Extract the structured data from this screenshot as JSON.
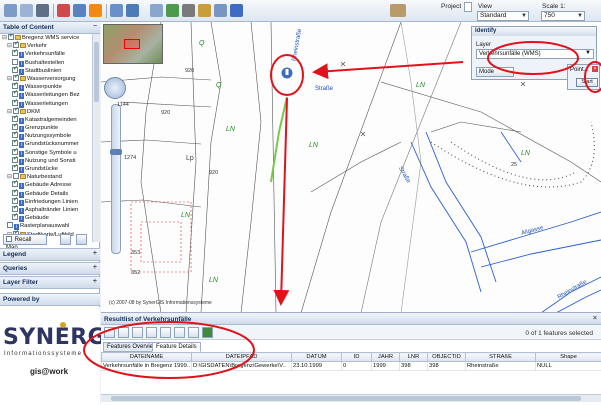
{
  "toolbar": {
    "project_label": "Project",
    "view_label": "View",
    "view_value": "Standard",
    "scale_label": "Scale 1:",
    "scale_value": "750",
    "icons": [
      "pan-icon",
      "zoom-icon",
      "print-icon",
      "select-icon",
      "measure-icon",
      "info-icon",
      "edit-icon",
      "layer-icon",
      "search-icon",
      "bookmark-icon",
      "pen-icon",
      "link-icon",
      "euro-icon",
      "help-icon"
    ]
  },
  "sidebar": {
    "toc_title": "Table of Content",
    "toc_items": [
      {
        "text": "Bregenz WMS service",
        "level": 0,
        "checked": true,
        "kind": "group"
      },
      {
        "text": "Verkehr",
        "level": 1,
        "checked": true,
        "kind": "group"
      },
      {
        "text": "Verkehrsunfälle",
        "level": 2,
        "checked": true,
        "kind": "layer"
      },
      {
        "text": "Bushaltestellen",
        "level": 2,
        "checked": false,
        "kind": "layer"
      },
      {
        "text": "Stadtbuslinien",
        "level": 2,
        "checked": true,
        "kind": "layer"
      },
      {
        "text": "Wasserversorgung",
        "level": 1,
        "checked": true,
        "kind": "group"
      },
      {
        "text": "Wasserpunkte",
        "level": 2,
        "checked": true,
        "kind": "layer"
      },
      {
        "text": "Wasserleitungen Bez",
        "level": 2,
        "checked": true,
        "kind": "layer"
      },
      {
        "text": "Wasserleitungen",
        "level": 2,
        "checked": true,
        "kind": "layer"
      },
      {
        "text": "DKM",
        "level": 1,
        "checked": true,
        "kind": "group"
      },
      {
        "text": "Katastralgemeinden",
        "level": 2,
        "checked": true,
        "kind": "layer"
      },
      {
        "text": "Grenzpunkte",
        "level": 2,
        "checked": true,
        "kind": "layer"
      },
      {
        "text": "Nutzungssymbole",
        "level": 2,
        "checked": true,
        "kind": "layer"
      },
      {
        "text": "Grundstücksnummer",
        "level": 2,
        "checked": true,
        "kind": "layer"
      },
      {
        "text": "Sonstige Symbole u",
        "level": 2,
        "checked": true,
        "kind": "layer"
      },
      {
        "text": "Nutzung und Sonsti",
        "level": 2,
        "checked": true,
        "kind": "layer"
      },
      {
        "text": "Grundstücke",
        "level": 2,
        "checked": true,
        "kind": "layer"
      },
      {
        "text": "Naturbestand",
        "level": 1,
        "checked": false,
        "kind": "group"
      },
      {
        "text": "Gebäude Adresse",
        "level": 2,
        "checked": true,
        "kind": "layer"
      },
      {
        "text": "Gebäude Details",
        "level": 2,
        "checked": true,
        "kind": "layer"
      },
      {
        "text": "Einfriedungen Linien",
        "level": 2,
        "checked": true,
        "kind": "layer"
      },
      {
        "text": "Asphaltränder Linien",
        "level": 2,
        "checked": true,
        "kind": "layer"
      },
      {
        "text": "Gebäude",
        "level": 2,
        "checked": true,
        "kind": "layer"
      },
      {
        "text": "Rasterplanauswahl",
        "level": 1,
        "checked": false,
        "kind": "layer"
      },
      {
        "text": "Stadtkarte/Luftbild",
        "level": 1,
        "checked": true,
        "kind": "group"
      }
    ],
    "recall_label": "Recall Map",
    "legend": "Legend",
    "queries": "Queries",
    "layer_filter": "Layer Filter",
    "powered_by": "Powered by",
    "logo_text": "SYNERGIS",
    "logo_sub": "Informationssysteme",
    "product": "gis@work"
  },
  "map": {
    "labels_green": [
      "Q",
      "Q",
      "LN",
      "LN",
      "LN",
      "LN",
      "LN",
      "LN",
      "Lp",
      "V",
      "V",
      "V",
      "V",
      "V"
    ],
    "numbers": [
      "920",
      "6",
      "1144",
      "920",
      "6",
      "920",
      "10",
      "1274",
      "920",
      "15",
      "920",
      "5",
      "LN",
      "25",
      "7",
      "8",
      "353",
      "2",
      "352",
      "7",
      "9",
      "4",
      "6"
    ],
    "streets": [
      "Straße",
      "Straße",
      "Aligasse",
      "Rheinstraße",
      "Rheinstraße"
    ],
    "copyright": "(c) 2007-08 by SynerGIS Informationssysteme"
  },
  "identify": {
    "title": "Identify",
    "layer_label": "Layer",
    "layer_value": "Verkehrsunfälle (WMS)",
    "mode_label": "Mode"
  },
  "point_window": {
    "title": "Point...",
    "start": "Start"
  },
  "results": {
    "title": "Resultlist of Verkehrsunfälle",
    "count": "0 of 1 features selected",
    "tabs": [
      "Features Overview",
      "Feature Details"
    ],
    "columns": [
      "DATEINAME",
      "DATEIPFAD",
      "DATUM",
      "ID",
      "JAHR",
      "LNR",
      "OBJECTID",
      "STRAßE",
      "Shape"
    ],
    "rows": [
      [
        "Verkehrsunfälle in Bregenz 1999..",
        "D:\\GISDATEN\\Bregenz\\Gewerke\\V..",
        "23.10.1999",
        "0",
        "1999",
        "398",
        "398",
        "Rheinstraße",
        "NULL"
      ]
    ]
  },
  "colors": {
    "annotation_red": "#e0131b",
    "accent_blue": "#15305a",
    "map_green": "#1c8a1c"
  }
}
